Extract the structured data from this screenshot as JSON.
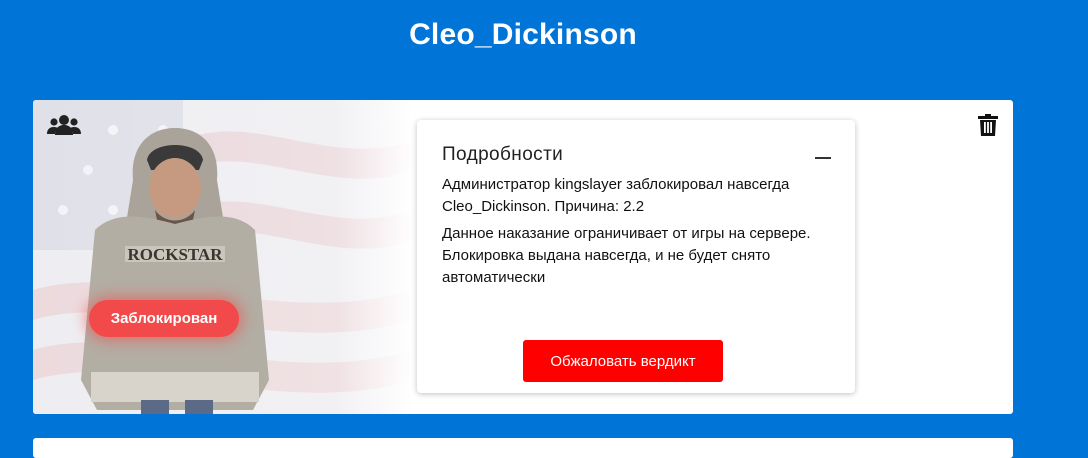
{
  "page": {
    "title": "Cleo_Dickinson"
  },
  "card": {
    "status_badge": "Заблокирован",
    "icons": {
      "group": "users-group-icon",
      "delete": "trash-icon"
    }
  },
  "details": {
    "title": "Подробности",
    "collapse_icon": "minus-icon",
    "text1": "Администратор kingslayer заблокировал навсегда Cleo_Dickinson. Причина: 2.2",
    "text2": "Данное наказание ограничивает от игры на сервере. Блокировка выдана навсегда, и не будет снято автоматически",
    "appeal_button": "Обжаловать вердикт"
  },
  "colors": {
    "background": "#0174d8",
    "badge": "#f24a4a",
    "appeal_button": "#ff0000"
  }
}
